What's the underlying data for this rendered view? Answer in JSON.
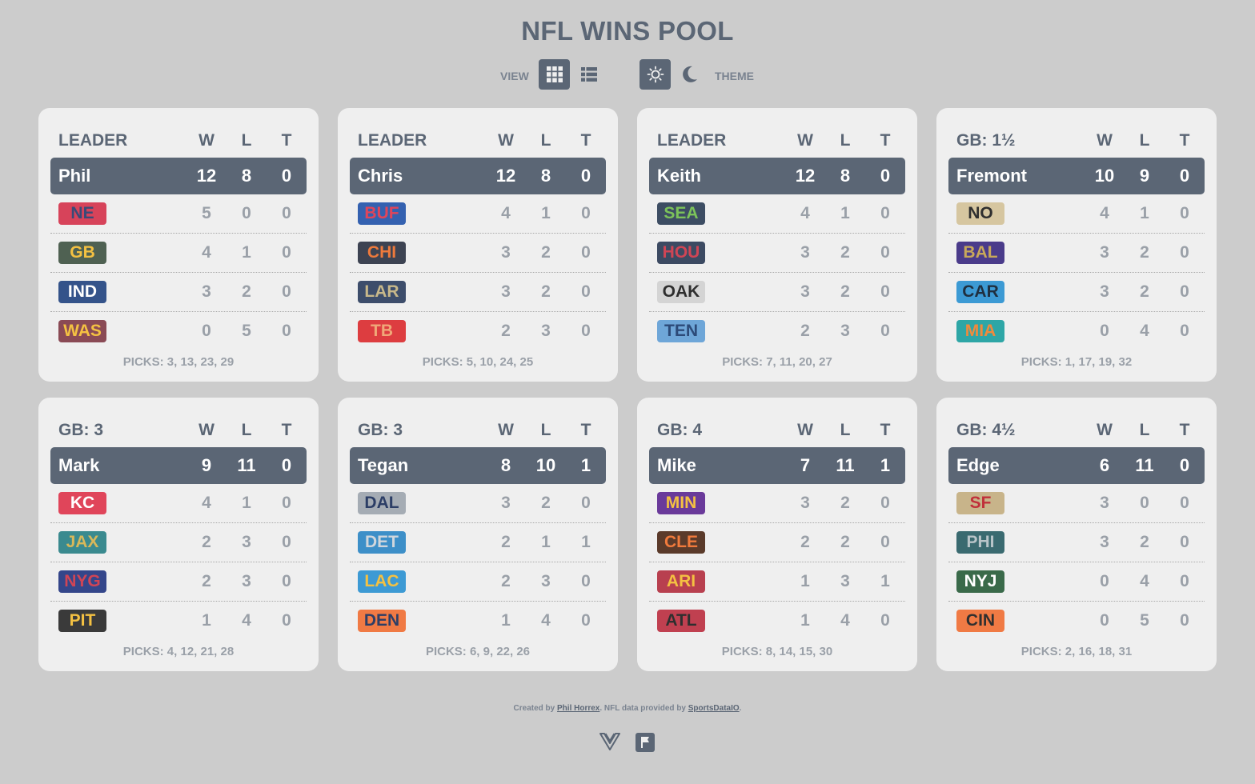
{
  "title": "NFL WINS POOL",
  "controls": {
    "view_label": "VIEW",
    "theme_label": "THEME",
    "grid_icon": "grid-icon",
    "list_icon": "list-icon",
    "sun_icon": "sun-icon",
    "moon_icon": "moon-icon"
  },
  "columns": {
    "w": "W",
    "l": "L",
    "t": "T"
  },
  "cards": [
    {
      "status": "LEADER",
      "owner": "Phil",
      "w": "12",
      "l": "8",
      "t": "0",
      "teams": [
        {
          "abbr": "NE",
          "w": "5",
          "l": "0",
          "t": "0",
          "bg": "#d7435a",
          "fg": "#3a4a78"
        },
        {
          "abbr": "GB",
          "w": "4",
          "l": "1",
          "t": "0",
          "bg": "#4f6152",
          "fg": "#f4c142"
        },
        {
          "abbr": "IND",
          "w": "3",
          "l": "2",
          "t": "0",
          "bg": "#34538a",
          "fg": "#ffffff"
        },
        {
          "abbr": "WAS",
          "w": "0",
          "l": "5",
          "t": "0",
          "bg": "#8a4a55",
          "fg": "#f4c142"
        }
      ],
      "picks": "PICKS: 3, 13, 23, 29"
    },
    {
      "status": "LEADER",
      "owner": "Chris",
      "w": "12",
      "l": "8",
      "t": "0",
      "teams": [
        {
          "abbr": "BUF",
          "w": "4",
          "l": "1",
          "t": "0",
          "bg": "#3461b0",
          "fg": "#e0455a"
        },
        {
          "abbr": "CHI",
          "w": "3",
          "l": "2",
          "t": "0",
          "bg": "#3d4352",
          "fg": "#ee7a3c"
        },
        {
          "abbr": "LAR",
          "w": "3",
          "l": "2",
          "t": "0",
          "bg": "#3d4d6b",
          "fg": "#c8b88a"
        },
        {
          "abbr": "TB",
          "w": "2",
          "l": "3",
          "t": "0",
          "bg": "#dd3d40",
          "fg": "#f0a878"
        }
      ],
      "picks": "PICKS: 5, 10, 24, 25"
    },
    {
      "status": "LEADER",
      "owner": "Keith",
      "w": "12",
      "l": "8",
      "t": "0",
      "teams": [
        {
          "abbr": "SEA",
          "w": "4",
          "l": "1",
          "t": "0",
          "bg": "#3d4d63",
          "fg": "#7cc35a"
        },
        {
          "abbr": "HOU",
          "w": "3",
          "l": "2",
          "t": "0",
          "bg": "#3c4a62",
          "fg": "#d04555"
        },
        {
          "abbr": "OAK",
          "w": "3",
          "l": "2",
          "t": "0",
          "bg": "#d4d4d4",
          "fg": "#2e2e2e"
        },
        {
          "abbr": "TEN",
          "w": "2",
          "l": "3",
          "t": "0",
          "bg": "#6ea6d8",
          "fg": "#2c4a78"
        }
      ],
      "picks": "PICKS: 7, 11, 20, 27"
    },
    {
      "status": "GB: 1½",
      "owner": "Fremont",
      "w": "10",
      "l": "9",
      "t": "0",
      "teams": [
        {
          "abbr": "NO",
          "w": "4",
          "l": "1",
          "t": "0",
          "bg": "#d6c6a0",
          "fg": "#2f2f2f"
        },
        {
          "abbr": "BAL",
          "w": "3",
          "l": "2",
          "t": "0",
          "bg": "#4a3b8a",
          "fg": "#c8a85a"
        },
        {
          "abbr": "CAR",
          "w": "3",
          "l": "2",
          "t": "0",
          "bg": "#3c9ad4",
          "fg": "#1f2f3f"
        },
        {
          "abbr": "MIA",
          "w": "0",
          "l": "4",
          "t": "0",
          "bg": "#2ea6a6",
          "fg": "#f08a3c"
        }
      ],
      "picks": "PICKS: 1, 17, 19, 32"
    },
    {
      "status": "GB: 3",
      "owner": "Mark",
      "w": "9",
      "l": "11",
      "t": "0",
      "teams": [
        {
          "abbr": "KC",
          "w": "4",
          "l": "1",
          "t": "0",
          "bg": "#e0455a",
          "fg": "#ffffff"
        },
        {
          "abbr": "JAX",
          "w": "2",
          "l": "3",
          "t": "0",
          "bg": "#3a8a8f",
          "fg": "#d8b85a"
        },
        {
          "abbr": "NYG",
          "w": "2",
          "l": "3",
          "t": "0",
          "bg": "#34468a",
          "fg": "#d04555"
        },
        {
          "abbr": "PIT",
          "w": "1",
          "l": "4",
          "t": "0",
          "bg": "#3a3a3a",
          "fg": "#f4c142"
        }
      ],
      "picks": "PICKS: 4, 12, 21, 28"
    },
    {
      "status": "GB: 3",
      "owner": "Tegan",
      "w": "8",
      "l": "10",
      "t": "1",
      "teams": [
        {
          "abbr": "DAL",
          "w": "3",
          "l": "2",
          "t": "0",
          "bg": "#a5acb4",
          "fg": "#2c3e66"
        },
        {
          "abbr": "DET",
          "w": "2",
          "l": "1",
          "t": "1",
          "bg": "#3d8fc8",
          "fg": "#d0d6dc"
        },
        {
          "abbr": "LAC",
          "w": "2",
          "l": "3",
          "t": "0",
          "bg": "#3d9ad4",
          "fg": "#f4c142"
        },
        {
          "abbr": "DEN",
          "w": "1",
          "l": "4",
          "t": "0",
          "bg": "#f07a44",
          "fg": "#2c3e66"
        }
      ],
      "picks": "PICKS: 6, 9, 22, 26"
    },
    {
      "status": "GB: 4",
      "owner": "Mike",
      "w": "7",
      "l": "11",
      "t": "1",
      "teams": [
        {
          "abbr": "MIN",
          "w": "3",
          "l": "2",
          "t": "0",
          "bg": "#6a3a9a",
          "fg": "#f4c142"
        },
        {
          "abbr": "CLE",
          "w": "2",
          "l": "2",
          "t": "0",
          "bg": "#5a3a2a",
          "fg": "#f07a3c"
        },
        {
          "abbr": "ARI",
          "w": "1",
          "l": "3",
          "t": "1",
          "bg": "#b8404f",
          "fg": "#f4c142"
        },
        {
          "abbr": "ATL",
          "w": "1",
          "l": "4",
          "t": "0",
          "bg": "#c04050",
          "fg": "#2f2f2f"
        }
      ],
      "picks": "PICKS: 8, 14, 15, 30"
    },
    {
      "status": "GB: 4½",
      "owner": "Edge",
      "w": "6",
      "l": "11",
      "t": "0",
      "teams": [
        {
          "abbr": "SF",
          "w": "3",
          "l": "0",
          "t": "0",
          "bg": "#c8b48a",
          "fg": "#c0303a"
        },
        {
          "abbr": "PHI",
          "w": "3",
          "l": "2",
          "t": "0",
          "bg": "#3a6a70",
          "fg": "#b8c4c8"
        },
        {
          "abbr": "NYJ",
          "w": "0",
          "l": "4",
          "t": "0",
          "bg": "#3a6a4a",
          "fg": "#ffffff"
        },
        {
          "abbr": "CIN",
          "w": "0",
          "l": "5",
          "t": "0",
          "bg": "#f07a44",
          "fg": "#2f2f2f"
        }
      ],
      "picks": "PICKS: 2, 16, 18, 31"
    }
  ],
  "footer": {
    "created_by": "Created by ",
    "author": "Phil Horrex",
    "data_by": ". NFL data provided by ",
    "provider": "SportsDataIO",
    "end": ".",
    "icons": [
      "vue-icon",
      "flag-icon"
    ]
  }
}
